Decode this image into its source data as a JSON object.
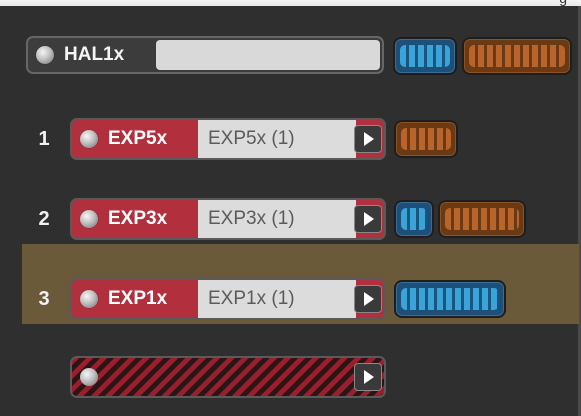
{
  "header_fragment": "g",
  "hal": {
    "label": "HAL1x",
    "field_value": "",
    "modules": [
      {
        "color": "blue",
        "icon": "blue-module-strip"
      },
      {
        "color": "orange",
        "icon": "orange-module-strip"
      }
    ]
  },
  "expanders": [
    {
      "number": "1",
      "label": "EXP5x",
      "value": "EXP5x (1)",
      "modules": [
        "orange"
      ],
      "selected": false
    },
    {
      "number": "2",
      "label": "EXP3x",
      "value": "EXP3x (1)",
      "modules": [
        "blue",
        "orange"
      ],
      "selected": false
    },
    {
      "number": "3",
      "label": "EXP1x",
      "value": "EXP1x (1)",
      "modules": [
        "blue"
      ],
      "selected": true
    }
  ],
  "empty_slot": {
    "icon": "hatched-empty-slot"
  },
  "colors": {
    "background": "#2f2f2f",
    "expander_red": "#b2303e",
    "module_blue": "#3aa3d8",
    "module_orange": "#b8642a",
    "selection": "#6b5a3a"
  }
}
